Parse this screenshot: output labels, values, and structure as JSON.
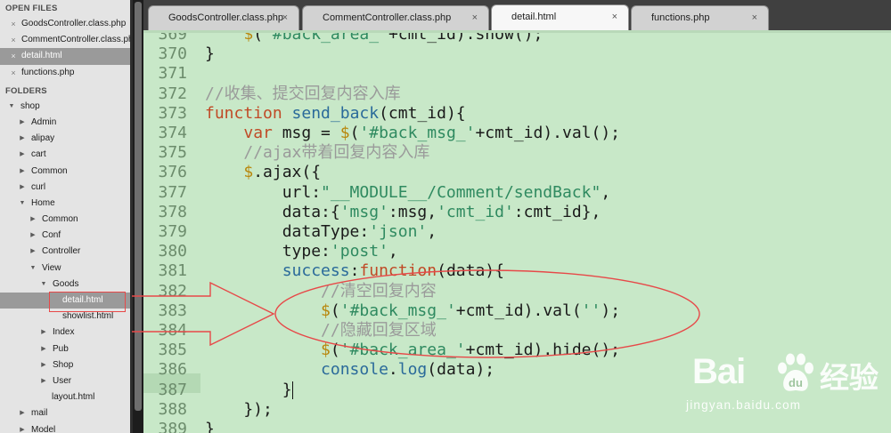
{
  "sidebar": {
    "open_files_title": "OPEN FILES",
    "open_files": [
      {
        "label": "GoodsController.class.php",
        "selected": false
      },
      {
        "label": "CommentController.class.php",
        "selected": false
      },
      {
        "label": "detail.html",
        "selected": true
      },
      {
        "label": "functions.php",
        "selected": false
      }
    ],
    "folders_title": "FOLDERS",
    "tree": [
      {
        "label": "shop",
        "type": "folder",
        "expanded": true
      },
      {
        "label": "Admin",
        "type": "folder"
      },
      {
        "label": "alipay",
        "type": "folder"
      },
      {
        "label": "cart",
        "type": "folder"
      },
      {
        "label": "Common",
        "type": "folder"
      },
      {
        "label": "curl",
        "type": "folder"
      },
      {
        "label": "Home",
        "type": "folder",
        "expanded": true
      },
      {
        "label": "Common",
        "type": "folder"
      },
      {
        "label": "Conf",
        "type": "folder"
      },
      {
        "label": "Controller",
        "type": "folder"
      },
      {
        "label": "View",
        "type": "folder",
        "expanded": true
      },
      {
        "label": "Goods",
        "type": "folder",
        "expanded": true
      },
      {
        "label": "detail.html",
        "type": "file",
        "selected": true
      },
      {
        "label": "showlist.html",
        "type": "file"
      },
      {
        "label": "Index",
        "type": "folder"
      },
      {
        "label": "Pub",
        "type": "folder"
      },
      {
        "label": "Shop",
        "type": "folder"
      },
      {
        "label": "User",
        "type": "folder"
      },
      {
        "label": "layout.html",
        "type": "file"
      },
      {
        "label": "mail",
        "type": "folder"
      },
      {
        "label": "Model",
        "type": "folder"
      }
    ]
  },
  "tabs": [
    {
      "label": "GoodsController.class.php",
      "active": false
    },
    {
      "label": "CommentController.class.php",
      "active": false
    },
    {
      "label": "detail.html",
      "active": true
    },
    {
      "label": "functions.php",
      "active": false
    }
  ],
  "close_glyph": "×",
  "editor": {
    "current_line": 387,
    "lines": [
      {
        "n": "369",
        "html": "    <span class=\"d\">$</span>(<span class=\"s\">'#back_area_'</span>+cmt_id).show();"
      },
      {
        "n": "370",
        "html": "}"
      },
      {
        "n": "371",
        "html": ""
      },
      {
        "n": "372",
        "html": "<span class=\"c\">//收集、提交回复内容入库</span>"
      },
      {
        "n": "373",
        "html": "<span class=\"kw\">function</span> <span class=\"fn\">send_back</span>(cmt_id){"
      },
      {
        "n": "374",
        "html": "    <span class=\"kw\">var</span> msg = <span class=\"d\">$</span>(<span class=\"s\">'#back_msg_'</span>+cmt_id).val();"
      },
      {
        "n": "375",
        "html": "    <span class=\"c\">//ajax带着回复内容入库</span>"
      },
      {
        "n": "376",
        "html": "    <span class=\"d\">$</span>.ajax({"
      },
      {
        "n": "377",
        "html": "        url:<span class=\"s\">\"__MODULE__/Comment/sendBack\"</span>,"
      },
      {
        "n": "378",
        "html": "        data:{<span class=\"s\">'msg'</span>:msg,<span class=\"s\">'cmt_id'</span>:cmt_id},"
      },
      {
        "n": "379",
        "html": "        dataType:<span class=\"s\">'json'</span>,"
      },
      {
        "n": "380",
        "html": "        type:<span class=\"s\">'post'</span>,"
      },
      {
        "n": "381",
        "html": "        <span class=\"fn\">success</span>:<span class=\"kw\">function</span>(data){"
      },
      {
        "n": "382",
        "html": "            <span class=\"c\">//清空回复内容</span>"
      },
      {
        "n": "383",
        "html": "            <span class=\"d\">$</span>(<span class=\"s\">'#back_msg_'</span>+cmt_id).val(<span class=\"s\">''</span>);"
      },
      {
        "n": "384",
        "html": "            <span class=\"c\">//隐藏回复区域</span>"
      },
      {
        "n": "385",
        "html": "            <span class=\"d\">$</span>(<span class=\"s\">'#back_area_'</span>+cmt_id).hide();"
      },
      {
        "n": "386",
        "html": "            <span class=\"fn\">console</span>.<span class=\"fn\">log</span>(data);"
      },
      {
        "n": "387",
        "html": "        }<span class=\"caret\"></span>"
      },
      {
        "n": "388",
        "html": "    });"
      },
      {
        "n": "389",
        "html": "}"
      }
    ]
  },
  "watermark": {
    "brand": "Bai du",
    "brand_cn": "经验",
    "url": "jingyan.baidu.com"
  },
  "colors": {
    "editor_bg": "#c8e8c8",
    "annotation_red": "#e74848",
    "keyword": "#c04a26",
    "string": "#2f8a60",
    "comment": "#9a9a9a"
  }
}
